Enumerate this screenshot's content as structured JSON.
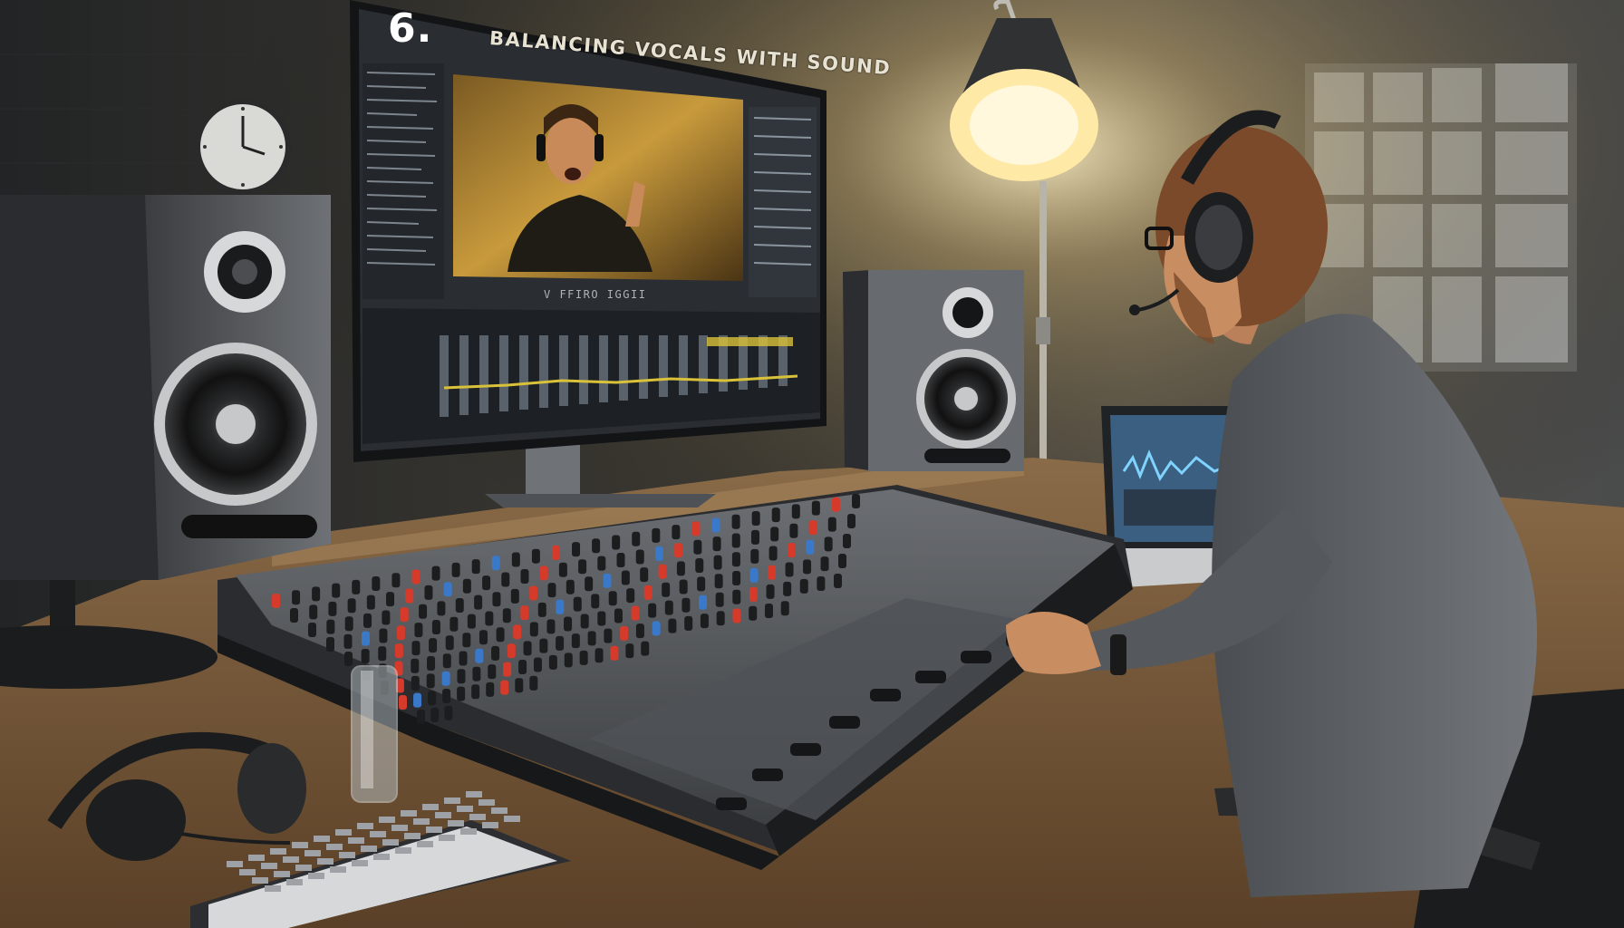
{
  "image": {
    "kind": "illustration",
    "alt": "Sound engineer with headphones sitting at a large mixing console in a studio, looking at a monitor showing a video of a singer and an audio editing timeline"
  },
  "monitor": {
    "step_number": "6.",
    "title": "BALANCING VOCALS WITH SOUND",
    "timeline_caption": "V FFIRO IGGII"
  },
  "palette": {
    "lamp_glow": "#ffe9a6",
    "fader_cap_red": "#d63a2b",
    "fader_cap_blue": "#3a78c9",
    "waveform": "#d9c23a"
  },
  "icons": {
    "wall_clock": "clock-icon",
    "headphones": "headphones-icon"
  }
}
